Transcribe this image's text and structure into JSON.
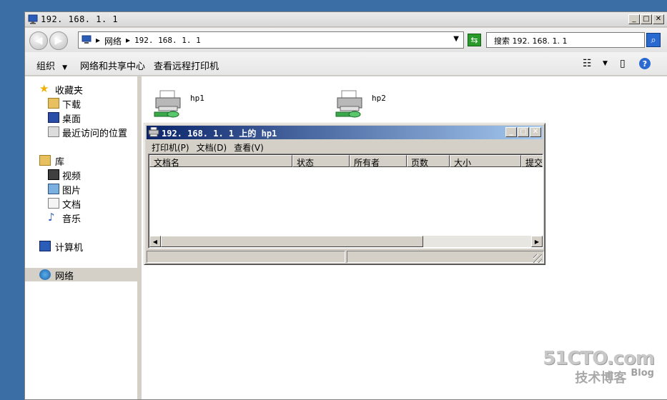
{
  "window": {
    "title": "192. 168. 1. 1"
  },
  "address": {
    "segment_network": "网络",
    "segment_host": "192. 168. 1. 1",
    "search_text": "搜索 192. 168. 1. 1"
  },
  "toolbar": {
    "organize": "组织",
    "network_center": "网络和共享中心",
    "view_printers": "查看远程打印机"
  },
  "sidebar": {
    "favorites": "收藏夹",
    "downloads": "下载",
    "desktop": "桌面",
    "recent": "最近访问的位置",
    "libraries": "库",
    "videos": "视频",
    "pictures": "图片",
    "documents": "文档",
    "music": "音乐",
    "computer": "计算机",
    "network": "网络"
  },
  "printers": [
    {
      "name": "hp1"
    },
    {
      "name": "hp2"
    }
  ],
  "dialog": {
    "title": "192. 168. 1. 1 上的 hp1",
    "menu": {
      "printer": "打印机(P)",
      "document": "文档(D)",
      "view": "查看(V)"
    },
    "columns": [
      "文档名",
      "状态",
      "所有者",
      "页数",
      "大小",
      "提交"
    ]
  },
  "watermark": {
    "brand": "51CTO.com",
    "sub": "技术博客",
    "blog": "Blog"
  },
  "colors": {
    "desktop": "#3a6ea5",
    "dialog_title_start": "#0a246a",
    "dialog_title_end": "#a6caf0",
    "chrome": "#d4d0c8"
  }
}
